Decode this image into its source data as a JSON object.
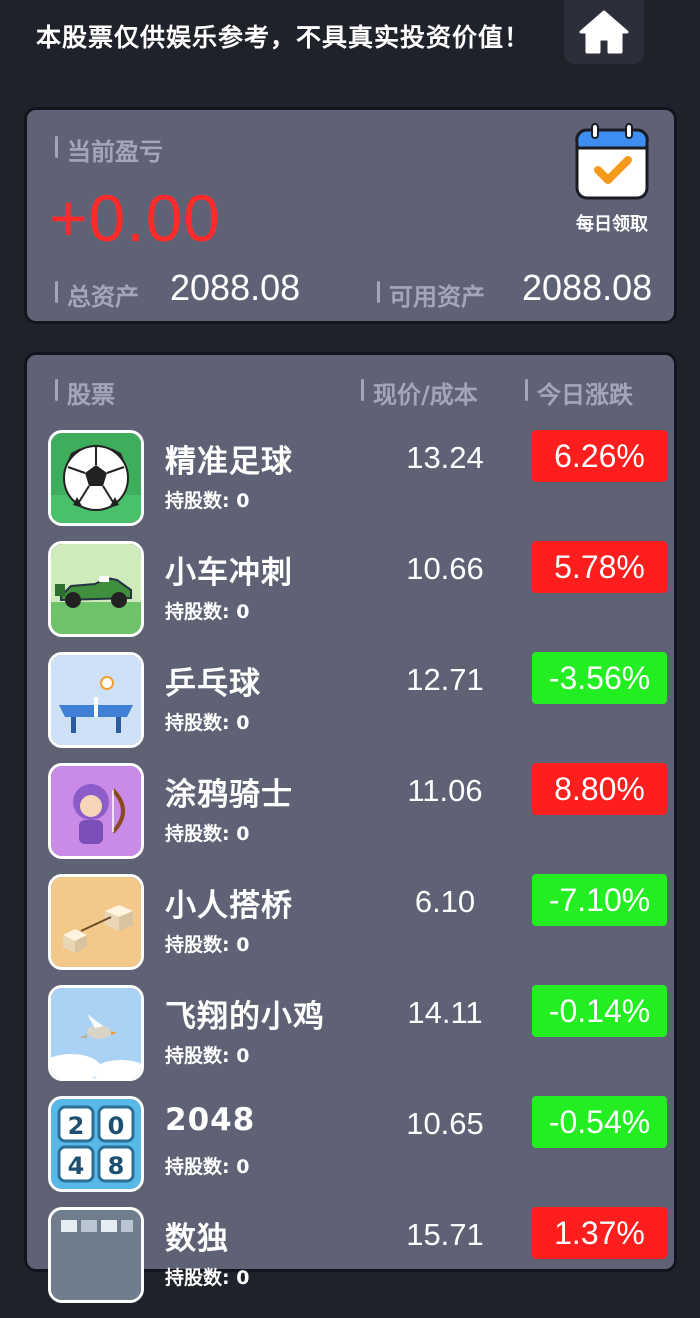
{
  "header": {
    "disclaimer": "本股票仅供娱乐参考，不具真实投资价值！",
    "home_icon": "home-icon"
  },
  "summary": {
    "pnl_label": "当前盈亏",
    "pnl_value": "+0.00",
    "pnl_color": "#ff2a2a",
    "total_assets_label": "总资产",
    "total_assets_value": "2088.08",
    "available_assets_label": "可用资产",
    "available_assets_value": "2088.08",
    "daily_claim_label": "每日领取",
    "daily_claim_icon": "calendar-check-icon"
  },
  "stock_list": {
    "headers": {
      "stock": "股票",
      "price_cost": "现价/成本",
      "today_change": "今日涨跌"
    },
    "holdings_prefix": "持股数: ",
    "colors": {
      "up": "#ff1e1e",
      "down": "#22ee22"
    },
    "items": [
      {
        "name": "精准足球",
        "holdings": "持股数: 0",
        "price": "13.24",
        "change": "6.26%",
        "direction": "up",
        "icon": "soccer-ball-icon"
      },
      {
        "name": "小车冲刺",
        "holdings": "持股数: 0",
        "price": "10.66",
        "change": "5.78%",
        "direction": "up",
        "icon": "race-car-icon"
      },
      {
        "name": "乒乓球",
        "holdings": "持股数: 0",
        "price": "12.71",
        "change": "-3.56%",
        "direction": "down",
        "icon": "ping-pong-table-icon"
      },
      {
        "name": "涂鸦骑士",
        "holdings": "持股数: 0",
        "price": "11.06",
        "change": "8.80%",
        "direction": "up",
        "icon": "archer-knight-icon"
      },
      {
        "name": "小人搭桥",
        "holdings": "持股数: 0",
        "price": "6.10",
        "change": "-7.10%",
        "direction": "down",
        "icon": "bridge-blocks-icon"
      },
      {
        "name": "飞翔的小鸡",
        "holdings": "持股数: 0",
        "price": "14.11",
        "change": "-0.14%",
        "direction": "down",
        "icon": "flying-bird-icon"
      },
      {
        "name": "2048",
        "holdings": "持股数: 0",
        "price": "10.65",
        "change": "-0.54%",
        "direction": "down",
        "icon": "2048-tiles-icon"
      },
      {
        "name": "数独",
        "holdings": "持股数: 0",
        "price": "15.71",
        "change": "1.37%",
        "direction": "up",
        "icon": "sudoku-grid-icon"
      }
    ]
  }
}
